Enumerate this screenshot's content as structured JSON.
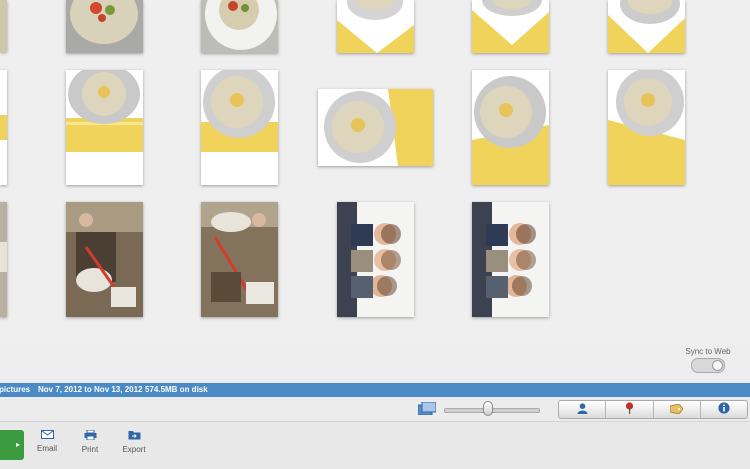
{
  "status": {
    "library": "pictures",
    "date_range": "Nov 7, 2012 to Nov 13, 2012",
    "disk_usage": "574.5MB on disk"
  },
  "sync": {
    "label": "Sync to Web"
  },
  "zoom": {
    "level": 0.45
  },
  "mode_buttons": [
    {
      "icon": "person-icon"
    },
    {
      "icon": "map-pin-icon"
    },
    {
      "icon": "tag-icon"
    },
    {
      "icon": "info-icon"
    }
  ],
  "actions": {
    "email": "Email",
    "print": "Print",
    "export": "Export"
  },
  "colors": {
    "status_bar": "#4a8bc6",
    "green_button": "#3c9b3f",
    "accent_blue": "#2f67a8",
    "map_pin": "#c0302b"
  }
}
